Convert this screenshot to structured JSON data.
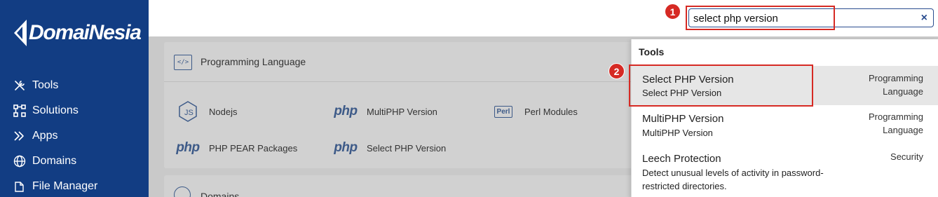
{
  "brand": {
    "name": "DomaiNesia"
  },
  "sidebar": {
    "items": [
      {
        "label": "Tools",
        "icon": "tools-icon"
      },
      {
        "label": "Solutions",
        "icon": "solutions-icon"
      },
      {
        "label": "Apps",
        "icon": "apps-icon"
      },
      {
        "label": "Domains",
        "icon": "globe-icon"
      },
      {
        "label": "File Manager",
        "icon": "folder-icon"
      }
    ]
  },
  "search": {
    "value": "select php version",
    "clear_label": "×"
  },
  "annotations": {
    "step1": "1",
    "step2": "2",
    "color": "#d62a24"
  },
  "main": {
    "section1": {
      "title": "Programming Language",
      "header_icon": "</>",
      "tools": [
        {
          "label": "Nodejs",
          "icon": "nodejs-icon"
        },
        {
          "label": "MultiPHP Version",
          "icon": "php-icon",
          "icon_text": "php"
        },
        {
          "label": "Perl Modules",
          "icon": "perl-icon",
          "icon_text": "Perl"
        },
        {
          "label": "PHP PEAR Packages",
          "icon": "php-pear-icon",
          "icon_text": "php"
        },
        {
          "label": "Select PHP Version",
          "icon": "php-select-icon",
          "icon_text": "php"
        }
      ]
    },
    "section2": {
      "title": "Domains"
    }
  },
  "dropdown": {
    "heading": "Tools",
    "results": [
      {
        "title": "Select PHP Version",
        "subtitle": "Select PHP Version",
        "category_line1": "Programming",
        "category_line2": "Language",
        "active": true
      },
      {
        "title": "MultiPHP Version",
        "subtitle": "MultiPHP Version",
        "category_line1": "Programming",
        "category_line2": "Language",
        "active": false
      },
      {
        "title": "Leech Protection",
        "subtitle_line1": "Detect unusual levels of activity in password-",
        "subtitle_line2": "restricted directories.",
        "category_line1": "Security",
        "active": false
      }
    ]
  },
  "colors": {
    "sidebar_bg": "#123d83",
    "accent": "#2a4d8f",
    "highlight": "#d62a24"
  }
}
